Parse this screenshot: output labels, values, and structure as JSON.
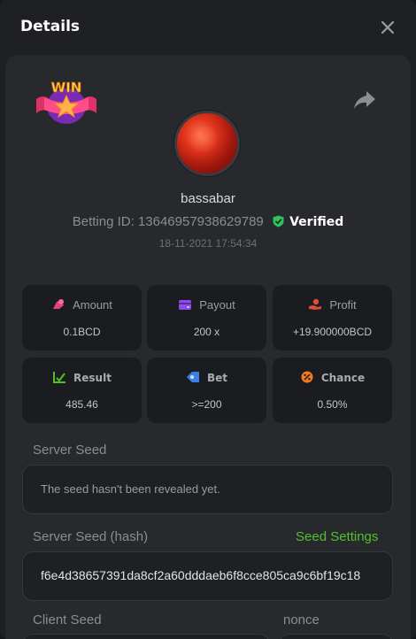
{
  "modal": {
    "title": "Details"
  },
  "player": {
    "username": "bassabar",
    "betting_id_label": "Betting ID:",
    "betting_id": "13646957938629789",
    "verified_label": "Verified",
    "timestamp": "18-11-2021 17:54:34"
  },
  "badge": {
    "text": "WIN"
  },
  "stats": [
    {
      "label": "Amount",
      "value": "0.1BCD",
      "icon": "coins-icon",
      "color": "#e0457a"
    },
    {
      "label": "Payout",
      "value": "200 x",
      "icon": "wallet-icon",
      "color": "#8a4de8"
    },
    {
      "label": "Profit",
      "value": "+19.900000BCD",
      "icon": "hand-coin-icon",
      "color": "#e04a3a"
    },
    {
      "label": "Result",
      "value": "485.46",
      "icon": "check-chart-icon",
      "color": "#53c02a"
    },
    {
      "label": "Bet",
      "value": ">=200",
      "icon": "tag-icon",
      "color": "#3b7fe6"
    },
    {
      "label": "Chance",
      "value": "0.50%",
      "icon": "percent-icon",
      "color": "#f07c1e"
    }
  ],
  "seeds": {
    "server_seed_label": "Server Seed",
    "server_seed_value": "The seed hasn't been revealed yet.",
    "server_hash_label": "Server Seed (hash)",
    "seed_settings_label": "Seed Settings",
    "server_hash_value": "f6e4d38657391da8cf2a60dddaeb6f8cce805ca9c6bf19c18",
    "client_seed_label": "Client Seed",
    "nonce_label": "nonce"
  },
  "colors": {
    "accent_green": "#4fc22b",
    "verified_green": "#2ec45a"
  }
}
